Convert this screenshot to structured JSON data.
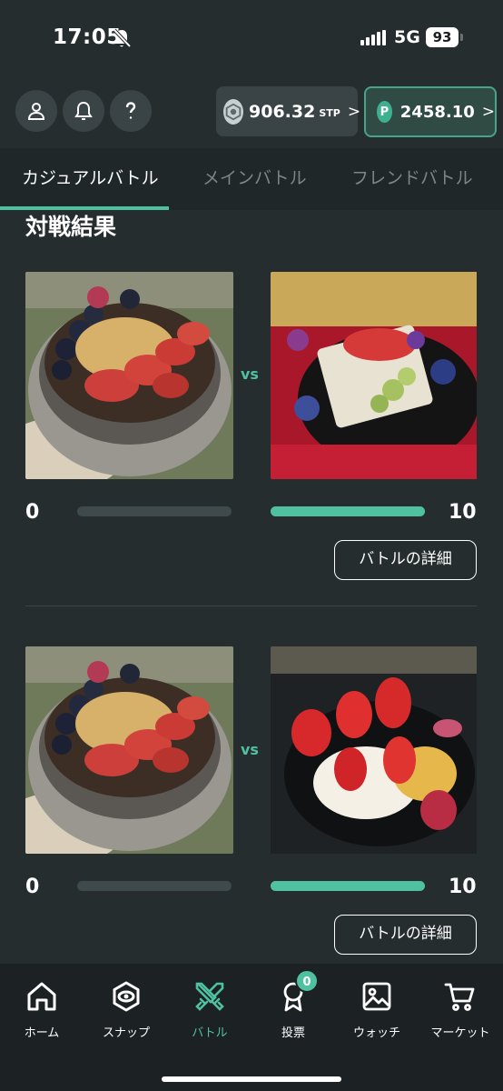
{
  "status": {
    "time": "17:05",
    "network": "5G",
    "battery": "93"
  },
  "header": {
    "stp_value": "906.32",
    "stp_unit": "STP",
    "points_value": "2458.10",
    "points_coin_label": "P",
    "chevron": ">"
  },
  "tabs": [
    {
      "label": "カジュアルバトル",
      "active": true
    },
    {
      "label": "メインバトル",
      "active": false
    },
    {
      "label": "フレンドバトル",
      "active": false
    }
  ],
  "section_title": "対戦結果",
  "battles": [
    {
      "left_score": "0",
      "right_score": "10",
      "vs": "vs",
      "detail_label": "バトルの詳細",
      "left_fill": 0.0,
      "right_fill": 1.0
    },
    {
      "left_score": "0",
      "right_score": "10",
      "vs": "vs",
      "detail_label": "バトルの詳細",
      "left_fill": 0.0,
      "right_fill": 1.0
    }
  ],
  "nav": [
    {
      "label": "ホーム",
      "icon": "home-icon"
    },
    {
      "label": "スナップ",
      "icon": "snap-icon"
    },
    {
      "label": "バトル",
      "icon": "battle-swords-icon",
      "active": true
    },
    {
      "label": "投票",
      "icon": "vote-ribbon-icon",
      "badge": "0"
    },
    {
      "label": "ウォッチ",
      "icon": "image-icon"
    },
    {
      "label": "マーケット",
      "icon": "cart-icon"
    }
  ],
  "colors": {
    "accent": "#4fc1a1",
    "background": "#262d2e",
    "track": "#3e4a4c"
  }
}
